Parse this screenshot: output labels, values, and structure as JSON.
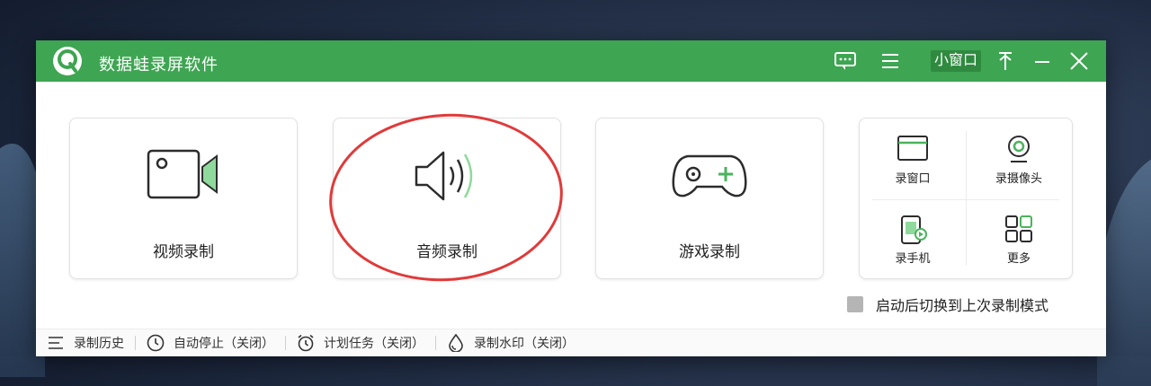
{
  "window": {
    "title": "数据蛙录屏软件",
    "mini_window_label": "小窗口"
  },
  "theme": {
    "accent": "#3ea552",
    "annotation_color": "#e03a3a"
  },
  "main_modes": [
    {
      "label": "视频录制",
      "icon": "video-camera-icon"
    },
    {
      "label": "音频录制",
      "icon": "speaker-icon"
    },
    {
      "label": "游戏录制",
      "icon": "gamepad-icon"
    }
  ],
  "extra_modes": [
    {
      "label": "录窗口",
      "icon": "window-icon"
    },
    {
      "label": "录摄像头",
      "icon": "webcam-icon"
    },
    {
      "label": "录手机",
      "icon": "phone-icon"
    },
    {
      "label": "更多",
      "icon": "grid-icon"
    }
  ],
  "option": {
    "label": "启动后切换到上次录制模式",
    "checked": false
  },
  "footer": [
    {
      "label": "录制历史",
      "icon": "list-icon"
    },
    {
      "label": "自动停止（关闭）",
      "icon": "clock-icon"
    },
    {
      "label": "计划任务（关闭）",
      "icon": "alarm-icon"
    },
    {
      "label": "录制水印（关闭）",
      "icon": "drop-icon"
    }
  ]
}
